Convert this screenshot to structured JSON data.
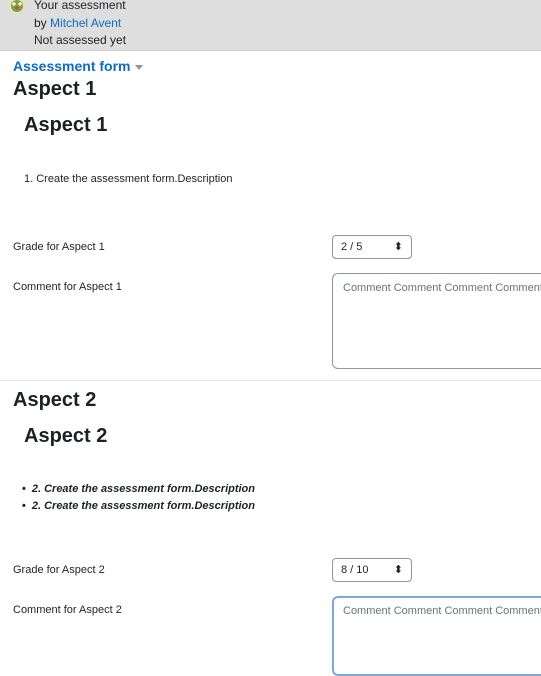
{
  "header": {
    "title": "Your assessment",
    "by_prefix": "by",
    "author": "Mitchel Avent",
    "status": "Not assessed yet"
  },
  "form_link": "Assessment form",
  "aspects": [
    {
      "heading": "Aspect 1",
      "subheading": "Aspect 1",
      "description": "1. Create the assessment form.Description",
      "grade_label": "Grade for Aspect 1",
      "grade_value": "2 / 5",
      "comment_label": "Comment for Aspect 1",
      "comment_value": "Comment Comment Comment Comment"
    },
    {
      "heading": "Aspect 2",
      "subheading": "Aspect 2",
      "bullets": [
        "2. Create the assessment form.Description",
        "2. Create the assessment form.Description"
      ],
      "grade_label": "Grade for Aspect 2",
      "grade_value": "8 / 10",
      "comment_label": "Comment for Aspect 2",
      "comment_value": "Comment Comment Comment Comment"
    }
  ],
  "icons": {
    "avatar": "user-avatar-icon",
    "dropdown": "chevron-down-icon",
    "select": "up-down-arrows-icon"
  }
}
